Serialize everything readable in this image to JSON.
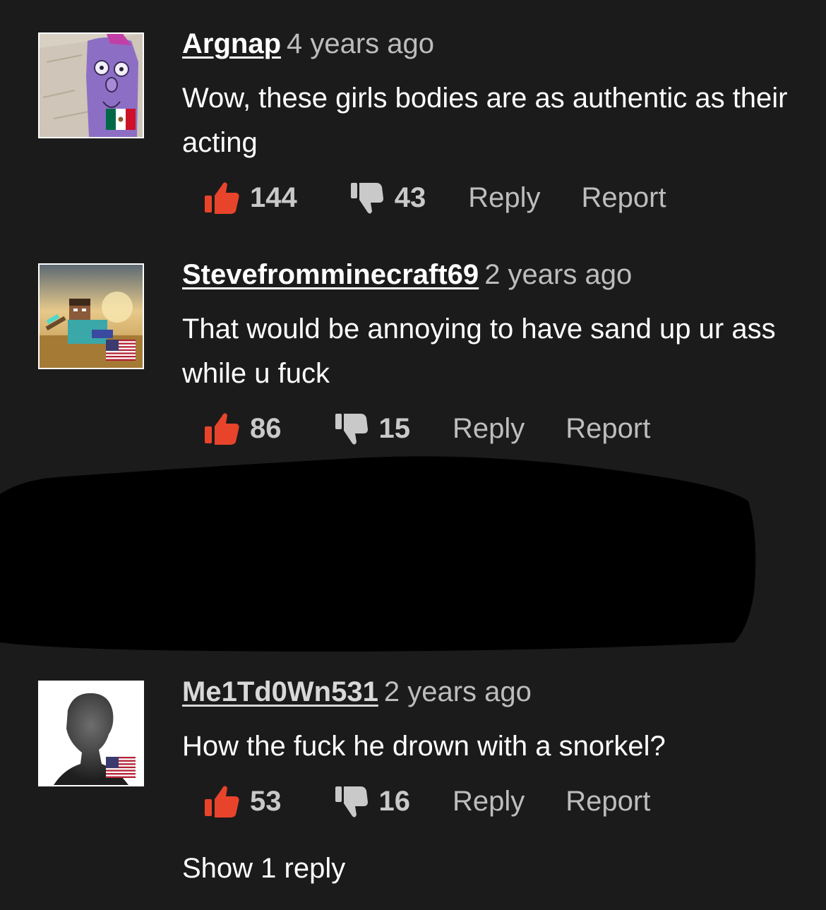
{
  "comments": [
    {
      "username": "Argnap",
      "timestamp": "4 years ago",
      "text": "Wow, these girls bodies are as authentic as their acting",
      "likes": "144",
      "dislikes": "43",
      "reply_label": "Reply",
      "report_label": "Report",
      "flag": "mexico-flag-icon"
    },
    {
      "username": "Stevefromminecraft69",
      "timestamp": "2 years ago",
      "text": "That would be annoying to have sand up ur ass while u fuck",
      "likes": "86",
      "dislikes": "15",
      "reply_label": "Reply",
      "report_label": "Report",
      "flag": "usa-flag-icon"
    },
    {
      "username": "Me1Td0Wn531",
      "timestamp": "2 years ago",
      "text": "How the fuck he drown with a snorkel?",
      "likes": "53",
      "dislikes": "16",
      "reply_label": "Reply",
      "report_label": "Report",
      "flag": "usa-flag-icon",
      "show_replies_label": "Show 1 reply"
    }
  ],
  "colors": {
    "background": "#1b1b1b",
    "like": "#e8442c",
    "dislike": "#c9c9c9",
    "muted_text": "#bdbdbd"
  }
}
